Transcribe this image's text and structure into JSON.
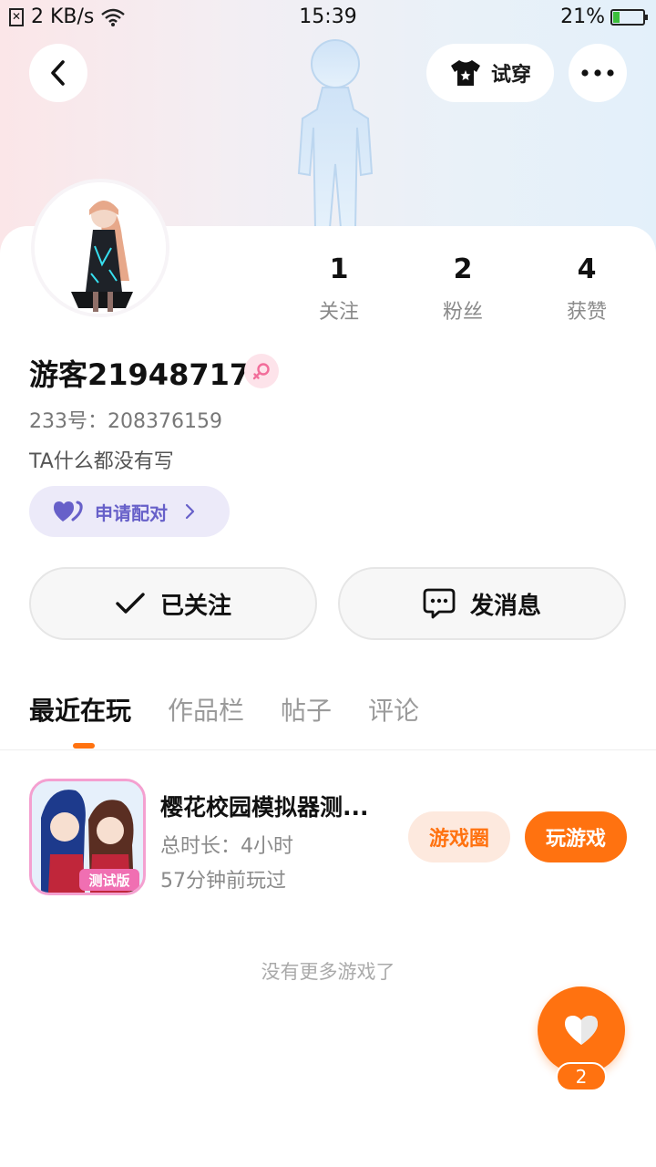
{
  "status_bar": {
    "network_speed": "2 KB/s",
    "time": "15:39",
    "battery_percent": "21%",
    "battery_level": 0.21
  },
  "header": {
    "try_on_label": "试穿"
  },
  "profile": {
    "username": "游客219487170",
    "uid_label": "233号：",
    "uid_value": "208376159",
    "bio": "TA什么都没有写",
    "pair_label": "申请配对",
    "stats": [
      {
        "num": "1",
        "label": "关注"
      },
      {
        "num": "2",
        "label": "粉丝"
      },
      {
        "num": "4",
        "label": "获赞"
      }
    ],
    "follow_label": "已关注",
    "message_label": "发消息"
  },
  "tabs": [
    "最近在玩",
    "作品栏",
    "帖子",
    "评论"
  ],
  "recent_games": [
    {
      "title": "樱花校园模拟器测...",
      "badge": "测试版",
      "duration": "总时长：4小时",
      "last_played": "57分钟前玩过",
      "circle_label": "游戏圈",
      "play_label": "玩游戏"
    }
  ],
  "no_more": "没有更多游戏了",
  "fab": {
    "count": "2"
  },
  "colors": {
    "accent": "#ff7210",
    "pair_text": "#6760c9",
    "pair_bg": "#eceaf9",
    "gender_bg": "#fde3ea"
  }
}
